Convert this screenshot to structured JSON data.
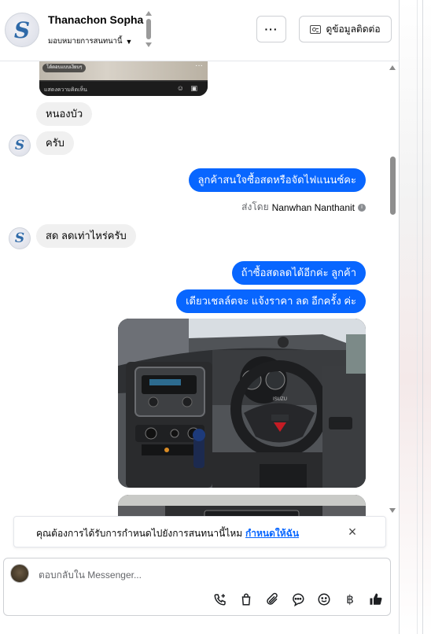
{
  "header": {
    "name": "Thanachon Sopha",
    "assign_label": "มอบหมายการสนทนานี้",
    "more_label": "···",
    "contact_button_label": "ดูข้อมูลติดต่อ",
    "avatar_initial": "S"
  },
  "thread_preview": {
    "chip_text": "โต้ตอบแบบเงียบๆ",
    "comment_bar_text": "แสดงความคิดเห็น"
  },
  "messages": [
    {
      "direction": "in",
      "text": "หนองบัว"
    },
    {
      "direction": "in",
      "text": "ครับ"
    },
    {
      "direction": "out",
      "text": "ลูกค้าสนใจซื้อสดหรือจัดไฟแนนซ์คะ"
    },
    {
      "direction": "in",
      "text": "สด ลดเท่าไหร่ครับ"
    },
    {
      "direction": "out",
      "text": "ถ้าซื้อสดลดได้อีกค่ะ  ลูกค้า"
    },
    {
      "direction": "out",
      "text": "เดียวเชลล์ตจะ แจ้งราคา ลด อีกครั้ง ค่ะ"
    }
  ],
  "sent_by": {
    "prefix": "ส่งโดย",
    "name": "Nanwhan Nanthanit"
  },
  "steering_brand": "ISUZU",
  "notification": {
    "text": "คุณต้องการได้รับการกำหนดไปยังการสนทนานี้ไหม",
    "link_label": "กำหนดให้ฉัน",
    "close_label": "×"
  },
  "composer": {
    "placeholder": "ตอบกลับใน Messenger...",
    "tools": [
      "phone-plus-icon",
      "shopping-bag-icon",
      "paperclip-icon",
      "chat-bubble-icon",
      "emoji-icon",
      "baht-icon",
      "thumbs-up-icon"
    ],
    "baht_symbol": "฿"
  },
  "colors": {
    "accent": "#0866ff",
    "incoming_bubble": "#f0f0f0"
  }
}
